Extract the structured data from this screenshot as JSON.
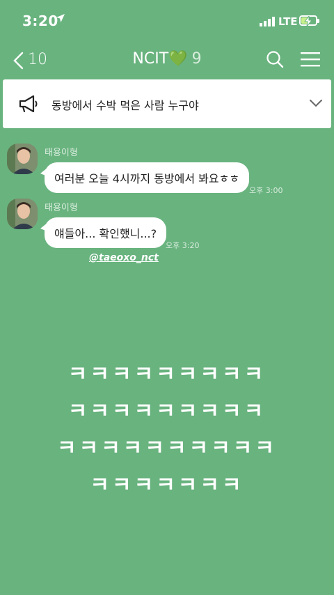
{
  "status_bar": {
    "time": "3:20",
    "network": "LTE"
  },
  "nav": {
    "back_count": "10",
    "title": "NCIT💚",
    "member_count": "9"
  },
  "notice": {
    "text": "동방에서 수박 먹은 사람 누구야"
  },
  "messages": [
    {
      "sender": "태용이형",
      "text": "여러분 오늘 4시까지 동방에서 봐요ㅎㅎ",
      "time": "오후 3:00"
    },
    {
      "sender": "태용이형",
      "text": "얘들아... 확인했니...?",
      "time": "오후 3:20"
    }
  ],
  "tag": "@taeoxo_nct",
  "overlay_lines": [
    "ㅋㅋㅋㅋㅋㅋㅋㅋㅋ",
    "ㅋㅋㅋㅋㅋㅋㅋㅋㅋ",
    "ㅋㅋㅋㅋㅋㅋㅋㅋㅋㅋ",
    "ㅋㅋㅋㅋㅋㅋㅋ"
  ]
}
